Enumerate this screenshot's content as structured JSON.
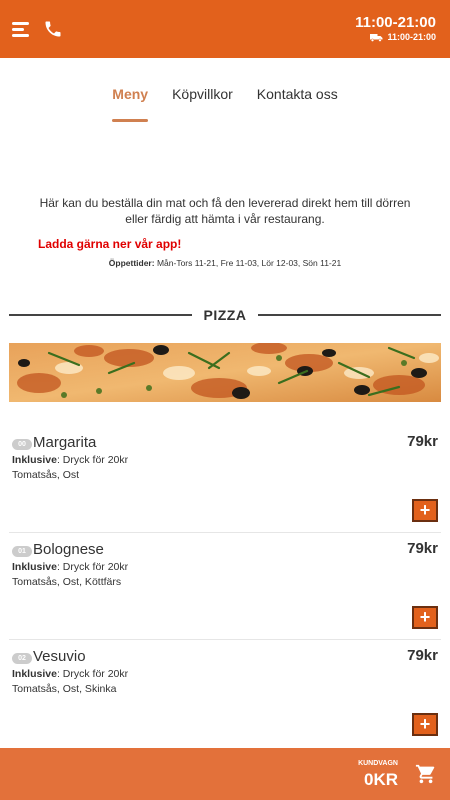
{
  "header": {
    "hours": "11:00-21:00",
    "delivery_hours": "11:00-21:00",
    "icons": [
      "menu-icon",
      "phone-icon",
      "delivery-truck-icon"
    ],
    "brand_color": "#e2611c"
  },
  "tabs": [
    {
      "label": "Meny",
      "active": true
    },
    {
      "label": "Köpvillkor",
      "active": false
    },
    {
      "label": "Kontakta oss",
      "active": false
    }
  ],
  "intro": {
    "line1": "Här kan du beställa din mat och få den levererad direkt hem till dörren",
    "line2": "eller färdig att hämta i vår restaurang.",
    "app_link": "Ladda gärna ner vår app!",
    "opening_label": "Öppettider:",
    "opening_text": "Mån-Tors 11-21, Fre 11-03, Lör 12-03, Sön 11-21"
  },
  "section": {
    "title": "PIZZA"
  },
  "items": [
    {
      "number": "00",
      "name": "Margarita",
      "price": "79kr",
      "incl_label": "Inklusive",
      "incl_text": ": Dryck för 20kr",
      "ingredients": "Tomatsås, Ost",
      "add_label": "+"
    },
    {
      "number": "01",
      "name": "Bolognese",
      "price": "79kr",
      "incl_label": "Inklusive",
      "incl_text": ": Dryck för 20kr",
      "ingredients": "Tomatsås, Ost, Köttfärs",
      "add_label": "+"
    },
    {
      "number": "02",
      "name": "Vesuvio",
      "price": "79kr",
      "incl_label": "Inklusive",
      "incl_text": ": Dryck för 20kr",
      "ingredients": "Tomatsås, Ost, Skinka",
      "add_label": "+"
    }
  ],
  "cart": {
    "label": "KUNDVAGN",
    "total": "0KR",
    "icon": "cart-icon"
  }
}
